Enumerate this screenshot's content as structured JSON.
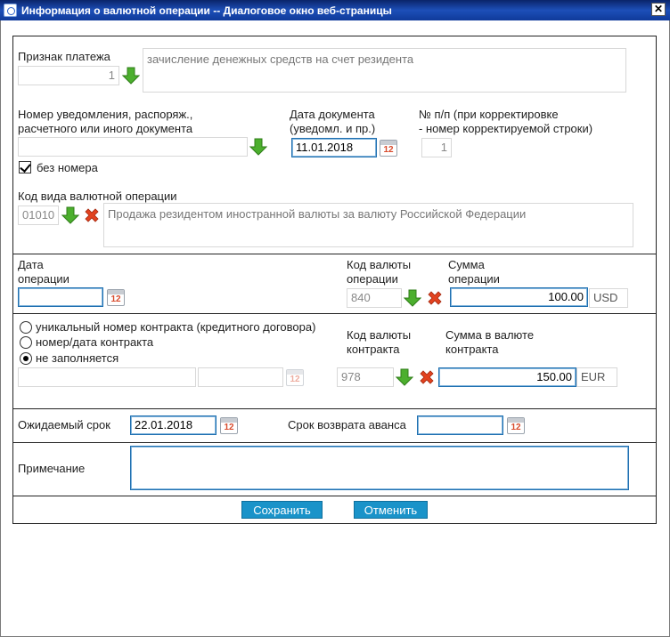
{
  "window": {
    "title": "Информация о валютной операции -- Диалоговое окно веб-страницы",
    "close_glyph": "✕"
  },
  "payment": {
    "label": "Признак платежа",
    "code": "1",
    "description": "зачисление денежных средств на счет резидента"
  },
  "notice": {
    "label_line1": "Номер уведомления, распоряж.,",
    "label_line2": "расчетного или иного документа",
    "value": "",
    "no_number_label": "без номера",
    "no_number_checked": true
  },
  "doc_date": {
    "label_line1": "Дата документа",
    "label_line2": "(уведомл. и пр.)",
    "value": "11.01.2018"
  },
  "row_number": {
    "label_line1": "№ п/п (при корректировке",
    "label_line2": "- номер корректируемой строки)",
    "value": "1"
  },
  "operation_kind": {
    "label": "Код вида валютной операции",
    "code": "01010",
    "description": "Продажа резидентом иностранной валюты за валюту Российской Федерации"
  },
  "operation": {
    "date_label_line1": "Дата",
    "date_label_line2": "операции",
    "date_value": "",
    "currency_label_line1": "Код валюты",
    "currency_label_line2": "операции",
    "currency_code": "840",
    "amount_label_line1": "Сумма",
    "amount_label_line2": "операции",
    "amount": "100.00",
    "amount_unit": "USD"
  },
  "contract": {
    "option_unique": "уникальный номер контракта (кредитного договора)",
    "option_number_date": "номер/дата контракта",
    "option_none": "не заполняется",
    "selected": "none",
    "number_value": "",
    "date_value": "",
    "currency_label_line1": "Код валюты",
    "currency_label_line2": "контракта",
    "currency_code": "978",
    "amount_label_line1": "Сумма в валюте",
    "amount_label_line2": "контракта",
    "amount": "150.00",
    "amount_unit": "EUR"
  },
  "term": {
    "expected_label": "Ожидаемый срок",
    "expected_value": "22.01.2018",
    "advance_label": "Срок возврата аванса",
    "advance_value": ""
  },
  "note": {
    "label": "Примечание",
    "value": ""
  },
  "actions": {
    "save": "Сохранить",
    "cancel": "Отменить"
  },
  "icons": {
    "calendar_number": "12",
    "arrow": "green-down-arrow-icon",
    "clear": "red-x-icon"
  },
  "colors": {
    "title_bar": "#1d4fb8",
    "button": "#1a93c9",
    "focus_border": "#1f6fb0",
    "arrow_green": "#4caf2e",
    "clear_red": "#e2421f"
  }
}
